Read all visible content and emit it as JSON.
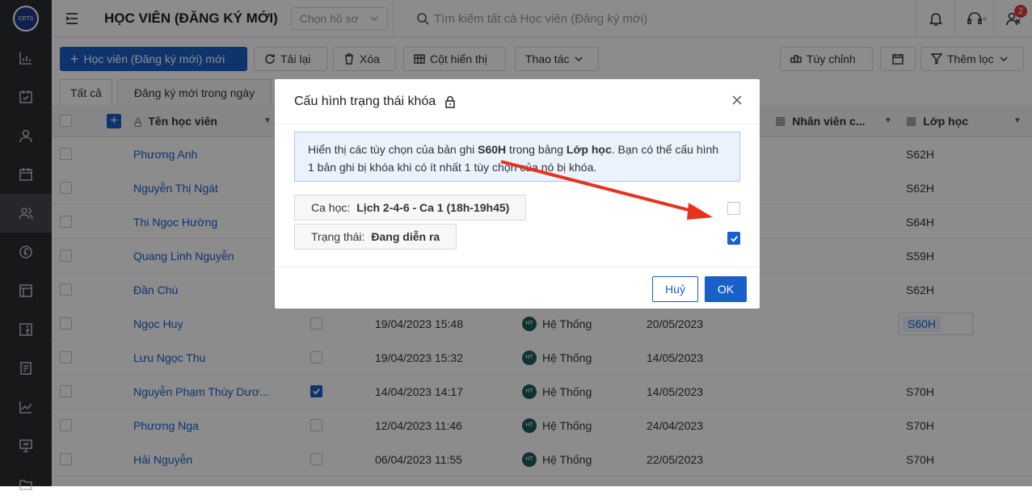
{
  "rail": {
    "logo_text": "CETS",
    "icons": [
      "chart-bar-icon",
      "calendar-check-icon",
      "user-icon",
      "calendar-icon",
      "users-icon",
      "currency-icon",
      "layout-icon",
      "facebook-icon",
      "document-list-icon",
      "line-chart-icon",
      "presentation-icon",
      "folder-icon"
    ]
  },
  "header": {
    "title": "HỌC VIÊN (ĐĂNG KÝ MỚI)",
    "profile_placeholder": "Chọn hồ sơ",
    "search_placeholder": "Tìm kiếm tất cả Học viên (Đăng ký mới)",
    "notification_count": "2"
  },
  "toolbar": {
    "add": "Học viên (Đăng ký mới) mới",
    "reload": "Tải lại",
    "delete": "Xóa",
    "columns": "Cột hiển thị",
    "actions": "Thao tác",
    "customize": "Tùy chỉnh",
    "add_filter": "Thêm lọc"
  },
  "tabs": [
    "Tất cả",
    "Đăng ký mới trong ngày"
  ],
  "table": {
    "headers": {
      "name": "Tên học viên",
      "staff": "Nhân viên c...",
      "class": "Lớp học"
    },
    "rows": [
      {
        "name": "Phương Anh",
        "created": "",
        "creator": "",
        "date": "",
        "cls": "S62H",
        "checked": false
      },
      {
        "name": "Nguyễn Thị Ngát",
        "created": "",
        "creator": "",
        "date": "",
        "cls": "S62H",
        "checked": false
      },
      {
        "name": "Thi Ngọc Hường",
        "created": "",
        "creator": "",
        "date": "",
        "cls": "S64H",
        "checked": false
      },
      {
        "name": "Quang Linh Nguyễn",
        "created": "",
        "creator": "",
        "date": "",
        "cls": "S59H",
        "checked": false
      },
      {
        "name": "Đần Chú",
        "created": "",
        "creator": "",
        "date": "",
        "cls": "S62H",
        "checked": false
      },
      {
        "name": "Ngọc Huy",
        "created": "19/04/2023 15:48",
        "creator": "Hệ Thống",
        "date": "20/05/2023",
        "cls": "S60H",
        "checked": false
      },
      {
        "name": "Lưu Ngọc Thu",
        "created": "19/04/2023 15:32",
        "creator": "Hệ Thống",
        "date": "14/05/2023",
        "cls": "",
        "checked": false
      },
      {
        "name": "Nguyễn Phạm Thùy Dươ...",
        "created": "14/04/2023 14:17",
        "creator": "Hệ Thống",
        "date": "14/05/2023",
        "cls": "S70H",
        "checked": true
      },
      {
        "name": "Phương Nga",
        "created": "12/04/2023 11:46",
        "creator": "Hệ Thống",
        "date": "24/04/2023",
        "cls": "S70H",
        "checked": false
      },
      {
        "name": "Hải Nguyễn",
        "created": "06/04/2023 11:55",
        "creator": "Hệ Thống",
        "date": "22/05/2023",
        "cls": "S70H",
        "checked": false
      }
    ],
    "avatar_initials": "HT"
  },
  "modal": {
    "title": "Cấu hình trạng thái khóa",
    "info_p1": "Hiển thị các tùy chọn của bản ghi ",
    "info_record": "S60H",
    "info_p2": " trong bảng ",
    "info_table": "Lớp học",
    "info_p3": ". Bạn có thể cấu hình 1 bản ghi bị khóa khi có ít nhất 1 tùy chọn của nó bị khóa.",
    "options": [
      {
        "label": "Ca học:",
        "value": "Lịch 2-4-6 - Ca 1 (18h-19h45)",
        "checked": false
      },
      {
        "label": "Trạng thái:",
        "value": "Đang diễn ra",
        "checked": true
      }
    ],
    "cancel": "Huỷ",
    "ok": "OK"
  },
  "colors": {
    "primary": "#1b5fc9",
    "annotation_arrow": "#e8321f"
  }
}
